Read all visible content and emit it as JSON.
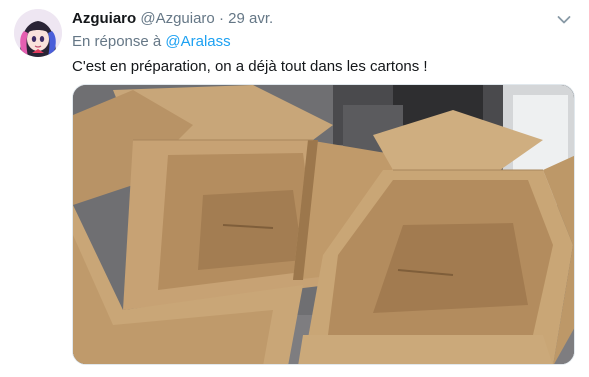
{
  "tweet": {
    "author_name": "Azguiaro",
    "author_handle": "@Azguiaro",
    "separator": "·",
    "date": "29 avr.",
    "reply_prefix": "En réponse à",
    "reply_to": "@Aralass",
    "text": "C'est en préparation, on a déjà tout dans les cartons !"
  },
  "icons": {
    "menu": "chevron-down-icon",
    "avatar": "anime-avatar"
  },
  "colors": {
    "link": "#1da1f2",
    "secondary_text": "#657786",
    "primary_text": "#14171a"
  }
}
